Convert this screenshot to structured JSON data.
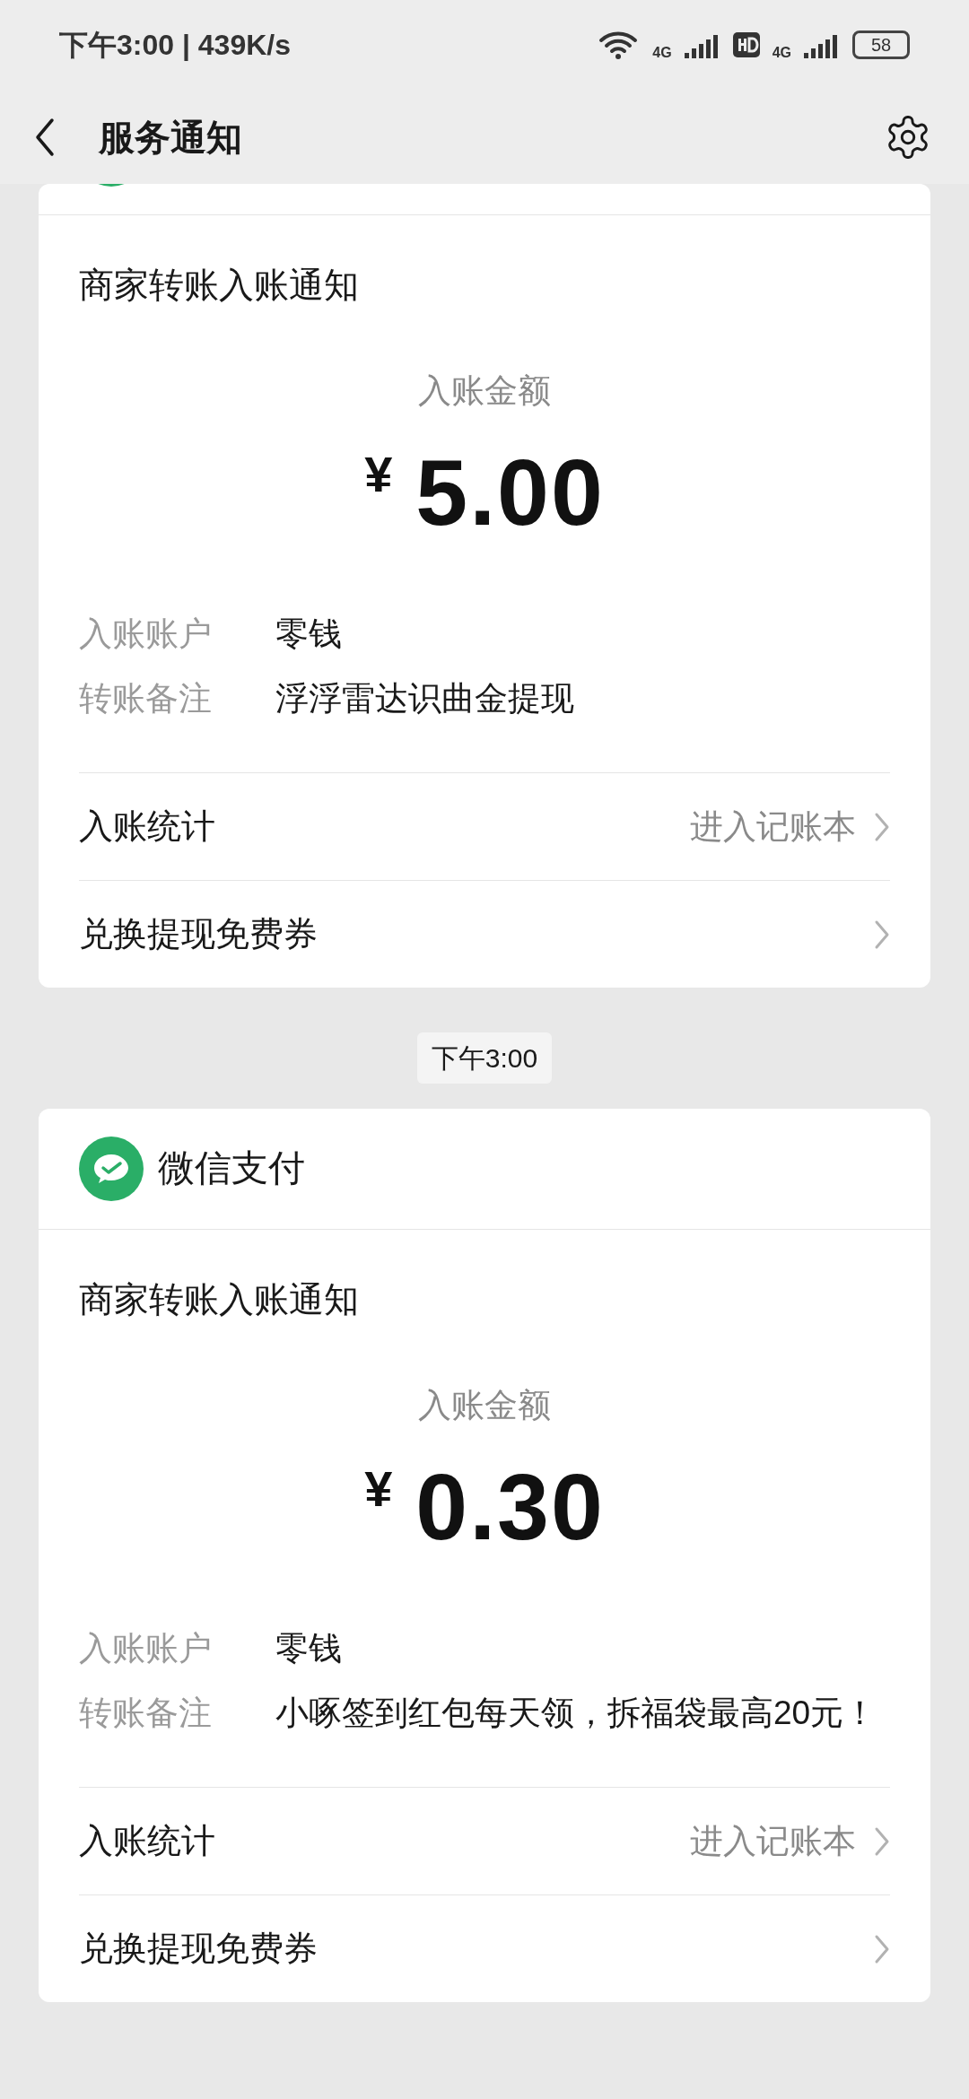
{
  "status_bar": {
    "time": "下午3:00 | 439K/s",
    "network_1": "4G",
    "network_2": "4G",
    "battery": "58"
  },
  "nav": {
    "title": "服务通知"
  },
  "messages": [
    {
      "kind": "cut_header",
      "title": "商家转账入账通知",
      "amount_label": "入账金额",
      "currency": "¥",
      "amount": "5.00",
      "fields": [
        {
          "label": "入账账户",
          "value": "零钱"
        },
        {
          "label": "转账备注",
          "value": "浮浮雷达识曲金提现"
        }
      ],
      "links": [
        {
          "label": "入账统计",
          "detail": "进入记账本"
        },
        {
          "label": "兑换提现免费券"
        }
      ]
    },
    {
      "kind": "full_header",
      "timestamp": "下午3:00",
      "app": "微信支付",
      "title": "商家转账入账通知",
      "amount_label": "入账金额",
      "currency": "¥",
      "amount": "0.30",
      "fields": [
        {
          "label": "入账账户",
          "value": "零钱"
        },
        {
          "label": "转账备注",
          "value": "小啄签到红包每天领，拆福袋最高20元！"
        }
      ],
      "links": [
        {
          "label": "入账统计",
          "detail": "进入记账本"
        },
        {
          "label": "兑换提现免费券"
        }
      ]
    }
  ]
}
